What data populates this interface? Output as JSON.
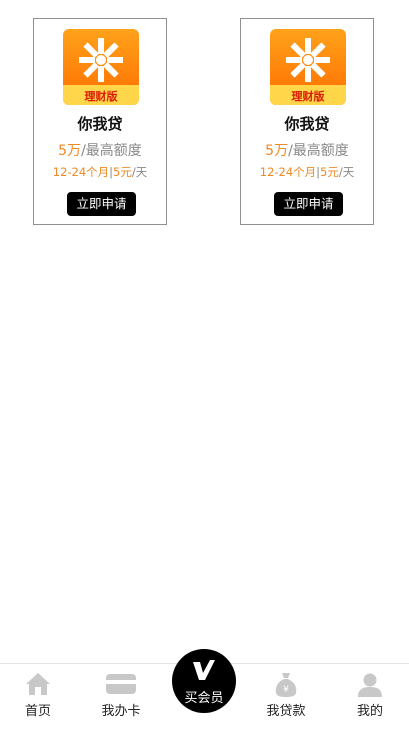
{
  "cards": [
    {
      "logo_badge": "理财版",
      "name": "你我贷",
      "amount": "5万",
      "amount_label": "/最高额度",
      "term": "12-24个月",
      "separator": "|",
      "rate": "5元",
      "rate_unit": "/天",
      "apply_label": "立即申请"
    },
    {
      "logo_badge": "理财版",
      "name": "你我贷",
      "amount": "5万",
      "amount_label": "/最高额度",
      "term": "12-24个月",
      "separator": "|",
      "rate": "5元",
      "rate_unit": "/天",
      "apply_label": "立即申请"
    }
  ],
  "tabbar": {
    "home": "首页",
    "card": "我办卡",
    "vip": "买会员",
    "loan": "我贷款",
    "mine": "我的"
  },
  "colors": {
    "accent": "#f08a24",
    "button": "#000000",
    "icon_gray": "#c8c8c8"
  }
}
